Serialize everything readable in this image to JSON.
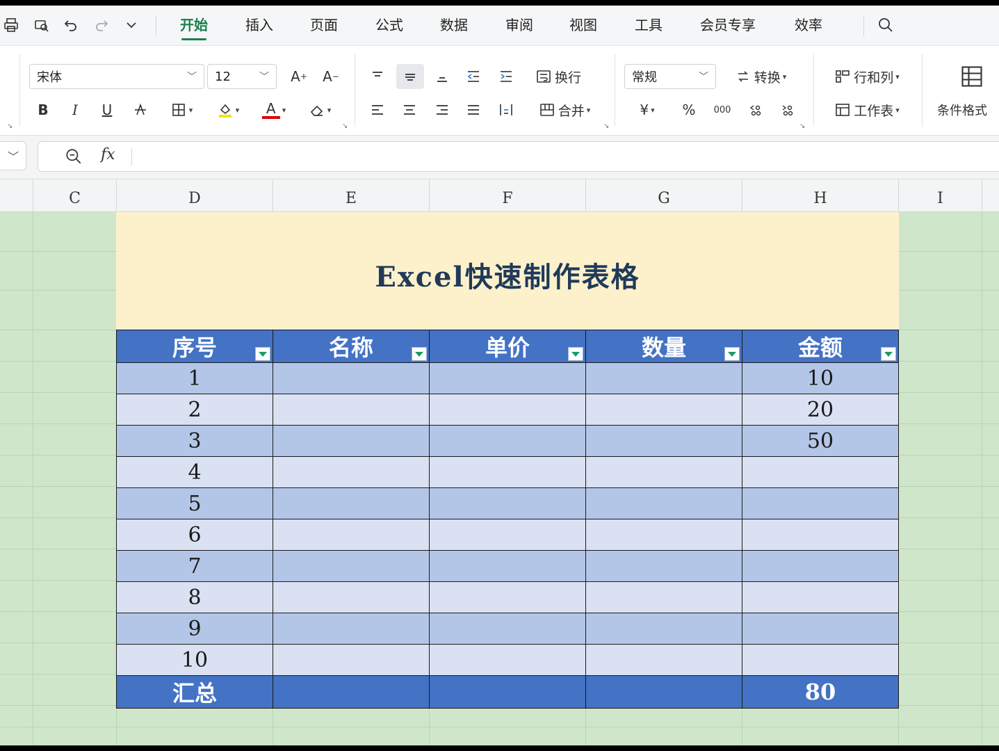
{
  "menu": {
    "tabs": [
      "开始",
      "插入",
      "页面",
      "公式",
      "数据",
      "审阅",
      "视图",
      "工具",
      "会员专享",
      "效率"
    ],
    "active_tab": "开始"
  },
  "ribbon": {
    "font_name": "宋体",
    "font_size": "12",
    "wrap_label": "换行",
    "merge_label": "合并",
    "number_format": "常规",
    "convert_label": "转换",
    "rows_cols_label": "行和列",
    "worksheet_label": "工作表",
    "cond_format_label": "条件格式",
    "bold": "B",
    "italic": "I",
    "underline": "U",
    "font_color_glyph": "A",
    "currency": "¥",
    "percent": "%",
    "thousands": "000"
  },
  "formula_bar": {
    "fx": "fx",
    "content": ""
  },
  "columns": [
    "C",
    "D",
    "E",
    "F",
    "G",
    "H",
    "I"
  ],
  "sheet": {
    "title": "Excel快速制作表格",
    "headers": [
      "序号",
      "名称",
      "单价",
      "数量",
      "金额"
    ],
    "rows": [
      [
        "1",
        "",
        "",
        "",
        "10"
      ],
      [
        "2",
        "",
        "",
        "",
        "20"
      ],
      [
        "3",
        "",
        "",
        "",
        "50"
      ],
      [
        "4",
        "",
        "",
        "",
        ""
      ],
      [
        "5",
        "",
        "",
        "",
        ""
      ],
      [
        "6",
        "",
        "",
        "",
        ""
      ],
      [
        "7",
        "",
        "",
        "",
        ""
      ],
      [
        "8",
        "",
        "",
        "",
        ""
      ],
      [
        "9",
        "",
        "",
        "",
        ""
      ],
      [
        "10",
        "",
        "",
        "",
        ""
      ]
    ],
    "summary": [
      "汇总",
      "",
      "",
      "",
      "80"
    ]
  },
  "colors": {
    "accent_green": "#1b7f4c",
    "header_blue": "#4472c4",
    "row_dark": "#b4c6e7",
    "row_light": "#d9e1f2",
    "title_fill": "#fdf1cc",
    "sheet_bg": "#cfe6cb"
  }
}
